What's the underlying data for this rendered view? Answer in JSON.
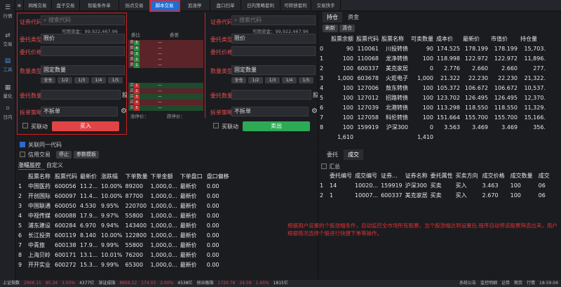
{
  "sidebar": [
    {
      "icon": "☰",
      "label": "行情"
    },
    {
      "icon": "⇄",
      "label": "交易"
    },
    {
      "icon": "▤",
      "label": "工具"
    },
    {
      "icon": "▦",
      "label": "量化"
    },
    {
      "icon": "⌗",
      "label": "日内"
    }
  ],
  "tabs": [
    "网格交易",
    "盘子交易",
    "智能条件单",
    "拐点交易",
    "脚本交易",
    "追涨停",
    "盘口扫单",
    "日内策略套利",
    "可转债套利",
    "交易快手"
  ],
  "active_tab": 4,
  "order_left": {
    "code_label": "证券代码",
    "code_placeholder": "搜索代码",
    "available": "可用资金：99,922,467.96",
    "entrust_type_label": "委托类型",
    "entrust_type_value": "限价",
    "price_label": "委托价格",
    "qty_type_label": "数量类型",
    "qty_type_value": "固定数量",
    "fractions": [
      "全仓",
      "1/2",
      "1/3",
      "1/4",
      "1/5"
    ],
    "qty_label": "委托数量",
    "qty_unit": "股",
    "split_label": "拆单策略",
    "split_value": "不拆单",
    "linkage_label": "买联动",
    "action_label": "买入"
  },
  "orderbook": {
    "h1": "委比",
    "h2": "委差",
    "sell_tags": [
      "5",
      "4",
      "3",
      "2",
      "1"
    ],
    "buy_tags": [
      "1",
      "2",
      "3",
      "4",
      "5"
    ],
    "sell_prefix": "卖",
    "buy_prefix": "买",
    "dash": "—",
    "footer1": "涨停价：",
    "footer2": "跌停价："
  },
  "order_right": {
    "code_label": "证券代码",
    "code_placeholder": "搜索代码",
    "available": "可用资金：99,922,467.96",
    "entrust_type_label": "委托类型",
    "entrust_type_value": "限价",
    "price_label": "委托价格",
    "qty_type_label": "数量类型",
    "qty_type_value": "固定数量",
    "fractions": [
      "全仓",
      "1/2",
      "1/3",
      "1/4",
      "1/5"
    ],
    "qty_label": "委托数量",
    "qty_unit": "股",
    "split_label": "拆单策略",
    "split_value": "不拆单",
    "linkage_label": "买联动",
    "action_label": "卖出"
  },
  "holdings": {
    "tabs": [
      "持仓",
      "资金"
    ],
    "buttons": [
      "刷新",
      "清仓"
    ],
    "columns": [
      "",
      "股票余额",
      "股票代码",
      "股票名称",
      "可卖数量",
      "成本价",
      "最新价",
      "市值价",
      "持仓量"
    ],
    "rows": [
      [
        "0",
        "90",
        "110061",
        "川投转债",
        "90",
        "174.525",
        "178.199",
        "178.199",
        "15,703."
      ],
      [
        "1",
        "100",
        "110068",
        "龙净转债",
        "100",
        "118.998",
        "122.972",
        "122.972",
        "11,896."
      ],
      [
        "2",
        "100",
        "600337",
        "美克家居",
        "0",
        "2.776",
        "2.660",
        "2.660",
        "277."
      ],
      [
        "3",
        "1,000",
        "603678",
        "火炬电子",
        "1,000",
        "21.322",
        "22.230",
        "22.230",
        "21,322."
      ],
      [
        "4",
        "100",
        "127006",
        "敖东转债",
        "100",
        "105.372",
        "106.672",
        "106.672",
        "10,537."
      ],
      [
        "5",
        "100",
        "127012",
        "招路转债",
        "100",
        "123.702",
        "126.495",
        "126.495",
        "12,370."
      ],
      [
        "6",
        "100",
        "127039",
        "北港转债",
        "100",
        "113.298",
        "118.550",
        "118.550",
        "11,329."
      ],
      [
        "7",
        "100",
        "127058",
        "科伦转债",
        "100",
        "151.664",
        "155.700",
        "155.700",
        "15,166."
      ],
      [
        "8",
        "100",
        "159919",
        "沪深300",
        "0",
        "3.563",
        "3.469",
        "3.469",
        "356."
      ]
    ],
    "totals": [
      "",
      "1,610",
      "",
      "",
      "1,410",
      "",
      "",
      "",
      ""
    ]
  },
  "entrust": {
    "tabs": [
      "委托",
      "成交"
    ],
    "summary_label": "汇总",
    "columns": [
      "",
      "委托编号",
      "成交编号",
      "证券...",
      "证券名称",
      "委托属性",
      "买卖方向",
      "成交价格",
      "成交数量",
      "成交"
    ],
    "rows": [
      [
        "1",
        "14",
        "10020...",
        "159919",
        "沪深300",
        "买卖",
        "买入",
        "3.463",
        "100",
        "06"
      ],
      [
        "2",
        "1",
        "10007...",
        "600337",
        "美克家居",
        "买卖",
        "买入",
        "2.670",
        "100",
        "06"
      ]
    ]
  },
  "options": {
    "linkage_label": "关联同一代码",
    "credit_label": "信用交易",
    "stop_btn": "停止",
    "params_btn": "参数模板"
  },
  "monitor": {
    "tabs": [
      "涨幅监控",
      "自定义"
    ],
    "columns": [
      "",
      "股票名称",
      "股票代码",
      "最新价",
      "涨跌幅",
      "下单数量",
      "下单金额",
      "下单盘口",
      "盘口偏移"
    ],
    "rows": [
      [
        "1",
        "中国医药",
        "600056",
        "11.2...",
        "10.00%",
        "89200",
        "1,000,0...",
        "最新价",
        "0.00"
      ],
      [
        "2",
        "开创国际",
        "600097",
        "11.4...",
        "10.00%",
        "87700",
        "1,000,0...",
        "最新价",
        "0.00"
      ],
      [
        "3",
        "中国联通",
        "600050",
        "4.530",
        "9.95%",
        "220700",
        "1,000,0...",
        "最新价",
        "0.00"
      ],
      [
        "4",
        "中视传媒",
        "600088",
        "17.9...",
        "9.97%",
        "55800",
        "1,000,0...",
        "最新价",
        "0.00"
      ],
      [
        "5",
        "浦东建设",
        "600284",
        "6.970",
        "9.94%",
        "143400",
        "1,000,0...",
        "最新价",
        "0.00"
      ],
      [
        "6",
        "长江投资",
        "600119",
        "8.140",
        "10.00%",
        "122800",
        "1,000,0...",
        "最新价",
        "0.00"
      ],
      [
        "7",
        "中青旅",
        "600138",
        "17.9...",
        "9.99%",
        "55800",
        "1,000,0...",
        "最新价",
        "0.00"
      ],
      [
        "8",
        "上海贝岭",
        "600171",
        "13.1...",
        "10.01%",
        "76200",
        "1,000,0...",
        "最新价",
        "0.00"
      ],
      [
        "9",
        "开开实业",
        "600272",
        "15.3...",
        "9.99%",
        "65300",
        "1,000,0...",
        "最新价",
        "0.00"
      ]
    ]
  },
  "note": "根据用户设置的个股涨幅条件，自动监控全市场所有股票，当个股涨幅达到设置后,程序自动将该股票筛选出来，用户根据情况选择个股进行快捷下单等操作。",
  "status": [
    {
      "text": "上证指数",
      "c": "#ccc"
    },
    {
      "text": "2906.11",
      "c": "#e04444"
    },
    {
      "text": "85.34",
      "c": "#e04444"
    },
    {
      "text": "3.03%",
      "c": "#e04444"
    },
    {
      "text": "4377亿",
      "c": "#ccc"
    },
    {
      "text": "深证成指",
      "c": "#ccc"
    },
    {
      "text": "8856.22",
      "c": "#e04444"
    },
    {
      "text": "174.03",
      "c": "#e04444"
    },
    {
      "text": "2.00%",
      "c": "#e04444"
    },
    {
      "text": "4538亿",
      "c": "#ccc"
    },
    {
      "text": "创业板指",
      "c": "#ccc"
    },
    {
      "text": "1720.78",
      "c": "#e04444"
    },
    {
      "text": "24.59",
      "c": "#e04444"
    },
    {
      "text": "1.45%",
      "c": "#e04444"
    },
    {
      "text": "1815亿",
      "c": "#ccc"
    }
  ],
  "status_right": [
    "系统公告",
    "监控明细",
    "证券",
    "期货",
    "行情",
    "18:59:04"
  ],
  "colors": {
    "accent": "#1d6fd6",
    "buy": "#e04444",
    "sell": "#2daa55",
    "highlight": "#d02020"
  }
}
